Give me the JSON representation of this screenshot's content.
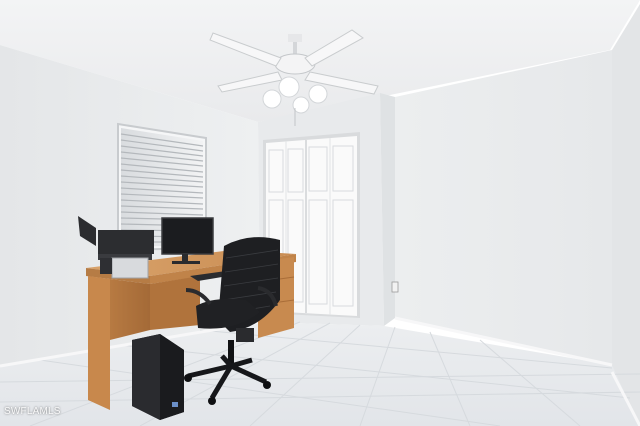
{
  "photo": {
    "watermark": "SWFLAMLS",
    "colors": {
      "wall": "#eceef0",
      "ceiling": "#f4f5f6",
      "floor_tile": "#e9ebee",
      "desk_wood": "#c98c52",
      "chair": "#1e1f22",
      "door": "#fafafa"
    }
  }
}
